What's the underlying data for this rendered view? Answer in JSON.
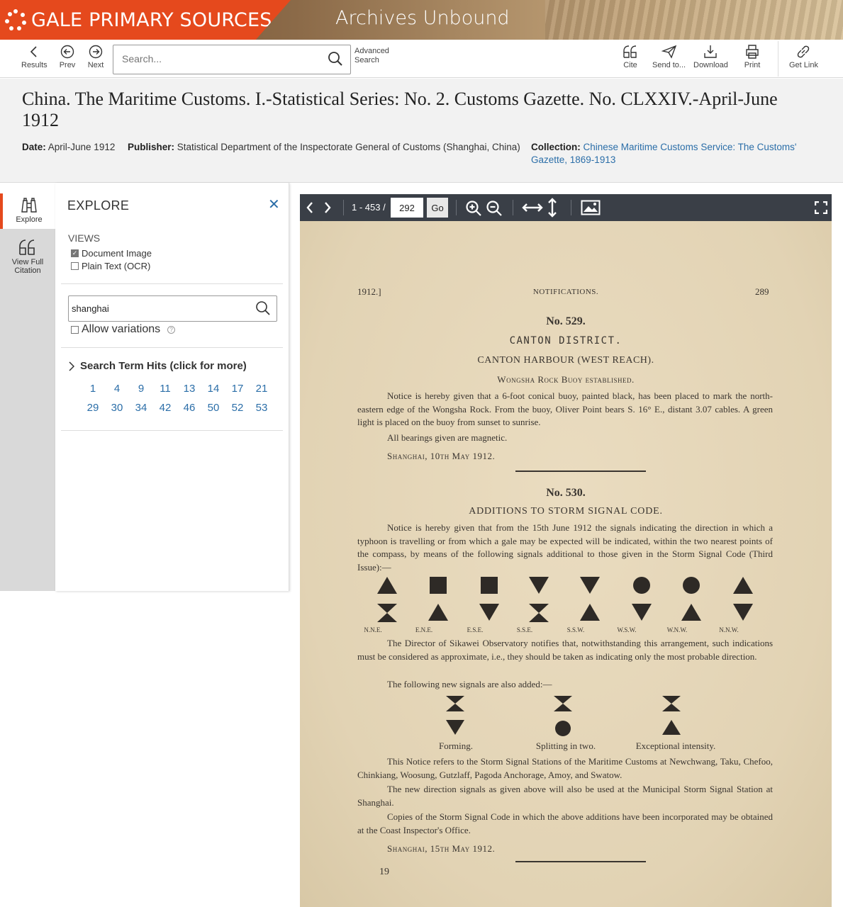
{
  "banner": {
    "brand": "GALE PRIMARY SOURCES",
    "product": "Archives Unbound"
  },
  "toolbar": {
    "results": "Results",
    "prev": "Prev",
    "next": "Next",
    "search_placeholder": "Search...",
    "advanced_line1": "Advanced",
    "advanced_line2": "Search",
    "cite": "Cite",
    "send_to": "Send to...",
    "download": "Download",
    "print": "Print",
    "get_link": "Get Link"
  },
  "document": {
    "title": "China. The Maritime Customs. I.-Statistical Series: No. 2. Customs Gazette. No. CLXXIV.-April-June 1912",
    "date_label": "Date:",
    "date": "April-June 1912",
    "publisher_label": "Publisher:",
    "publisher": "Statistical Department of the Inspectorate General of Customs (Shanghai, China)",
    "collection_label": "Collection:",
    "collection": "Chinese Maritime Customs Service: The Customs' Gazette, 1869-1913"
  },
  "rail": {
    "explore": "Explore",
    "citation_line1": "View Full",
    "citation_line2": "Citation"
  },
  "explore": {
    "title": "EXPLORE",
    "views_label": "VIEWS",
    "view_document": "Document Image",
    "view_text": "Plain Text (OCR)",
    "search_value": "shanghai",
    "allow_variations": "Allow variations",
    "hits_label": "Search Term Hits (click for more)",
    "hits": [
      "1",
      "4",
      "9",
      "11",
      "13",
      "14",
      "17",
      "21",
      "29",
      "30",
      "34",
      "42",
      "46",
      "50",
      "52",
      "53"
    ]
  },
  "viewer": {
    "page_range": "1 - 453 /",
    "page_value": "292",
    "go_label": "Go"
  },
  "page": {
    "year": "1912.]",
    "header": "NOTIFICATIONS.",
    "page_number": "289",
    "no529": "No. 529.",
    "district": "CANTON DISTRICT.",
    "harbour": "CANTON HARBOUR (WEST REACH).",
    "buoy": "Wongsha Rock Buoy established.",
    "p1": "Notice is hereby given that a 6-foot conical buoy, painted black, has been placed to mark the north-eastern edge of the Wongsha Rock. From the buoy, Oliver Point bears S. 16° E., distant 3.07 cables. A green light is placed on the buoy from sunset to sunrise.",
    "p2": "All bearings given are magnetic.",
    "sig1": "Shanghai, 10th May 1912.",
    "no530": "No. 530.",
    "additions": "ADDITIONS TO STORM SIGNAL CODE.",
    "p3": "Notice is hereby given that from the 15th June 1912 the signals indicating the direction in which a typhoon is travelling or from which a gale may be expected will be indicated, within the two nearest points of the compass, by means of the following signals additional to those given in the Storm Signal Code (Third Issue):—",
    "directions": [
      "N.N.E.",
      "E.N.E.",
      "E.S.E.",
      "S.S.E.",
      "S.S.W.",
      "W.S.W.",
      "W.N.W.",
      "N.N.W."
    ],
    "p4": "The Director of Sikawei Observatory notifies that, notwithstanding this arrangement, such indications must be considered as approximate, i.e., they should be taken as indicating only the most probable direction.",
    "p5": "The following new signals are also added:—",
    "new_signals": [
      "Forming.",
      "Splitting in two.",
      "Exceptional intensity."
    ],
    "p6": "This Notice refers to the Storm Signal Stations of the Maritime Customs at Newchwang, Taku, Chefoo, Chinkiang, Woosung, Gutzlaff, Pagoda Anchorage, Amoy, and Swatow.",
    "p7": "The new direction signals as given above will also be used at the Municipal Storm Signal Station at Shanghai.",
    "p8": "Copies of the Storm Signal Code in which the above additions have been incorporated may be obtained at the Coast Inspector's Office.",
    "sig2": "Shanghai, 15th May 1912.",
    "footer_num": "19"
  }
}
